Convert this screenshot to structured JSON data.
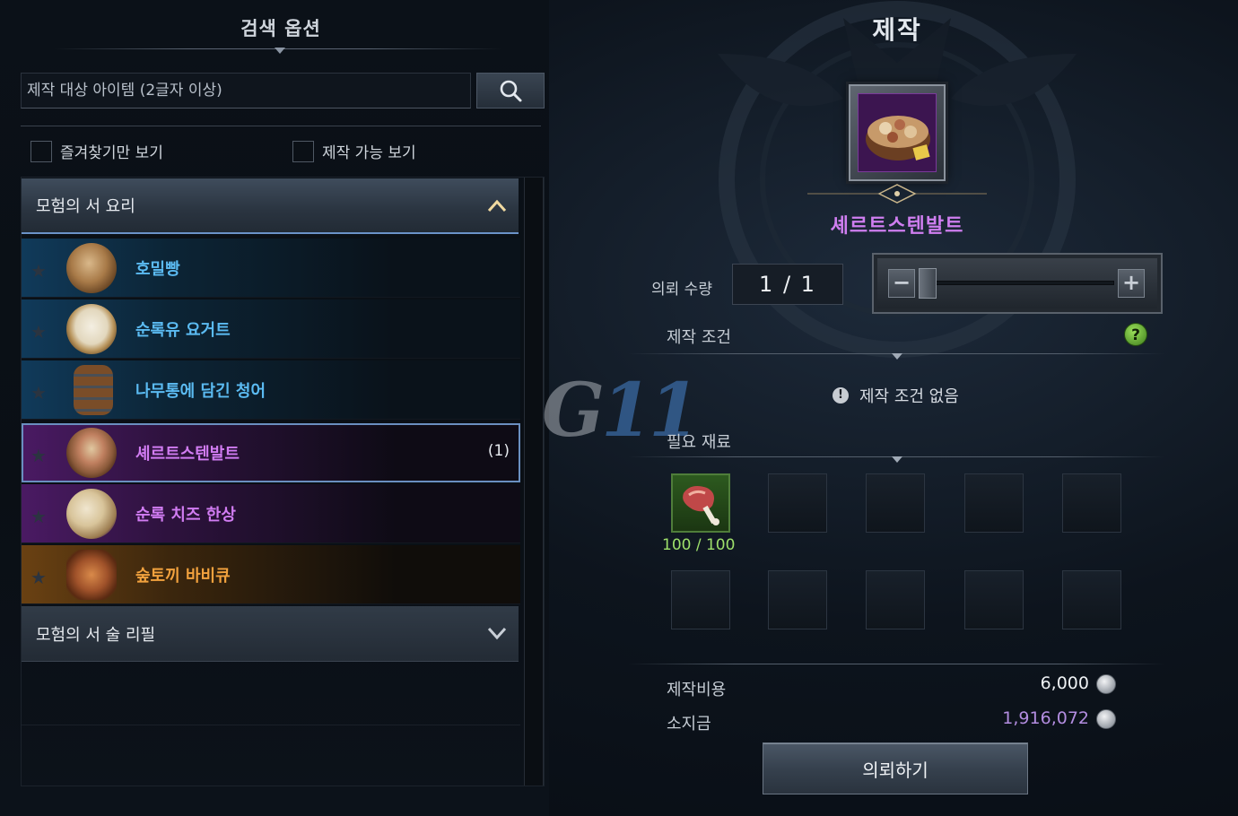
{
  "search": {
    "title": "검색 옵션",
    "placeholder": "제작 대상 아이템 (2글자 이상)",
    "favorites_label": "즐겨찾기만 보기",
    "craftable_label": "제작 가능 보기"
  },
  "categories": [
    {
      "label": "모험의 서 요리",
      "expanded": true,
      "items": [
        {
          "name": "호밀빵",
          "grade": "blue",
          "count": ""
        },
        {
          "name": "순록유 요거트",
          "grade": "blue",
          "count": ""
        },
        {
          "name": "나무통에 담긴 청어",
          "grade": "blue",
          "count": ""
        },
        {
          "name": "셰르트스텐발트",
          "grade": "purple",
          "count": "(1)",
          "selected": true
        },
        {
          "name": "순록 치즈 한상",
          "grade": "purple",
          "count": ""
        },
        {
          "name": "숲토끼 바비큐",
          "grade": "orange",
          "count": ""
        }
      ]
    },
    {
      "label": "모험의 서 술 리필",
      "expanded": false
    }
  ],
  "craft": {
    "title": "제작",
    "item_name": "셰르트스텐발트",
    "quantity_label": "의뢰 수량",
    "quantity_value": "1 / 1",
    "slider_level": 0,
    "condition_label": "제작 조건",
    "no_condition_text": "제작 조건 없음",
    "materials_label": "필요 재료",
    "materials": [
      {
        "icon": "meat-icon",
        "count": "100 / 100"
      }
    ],
    "cost_label": "제작비용",
    "cost_value": "6,000",
    "gold_label": "소지금",
    "gold_value": "1,916,072",
    "request_button": "의뢰하기"
  },
  "watermark": "G11",
  "colors": {
    "blue_grade": "#5bbbf2",
    "purple_grade": "#d17cf2",
    "orange_grade": "#f2a23e",
    "material_ok": "#9ee06b",
    "gold_value": "#b38de0"
  }
}
